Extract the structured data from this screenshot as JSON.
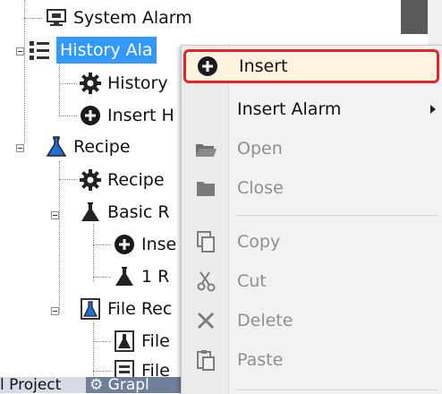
{
  "tree": {
    "system_alarm": "System Alarm",
    "history_alarm": "History Ala",
    "history_setting": "History",
    "insert_history": "Insert H",
    "recipe": "Recipe",
    "recipe_setting": "Recipe",
    "basic_recipe": "Basic R",
    "insert_basic": "Inse",
    "recipe_1": "1 R",
    "file_recipe": "File Rec",
    "file_item_1": "File",
    "file_item_2": "File"
  },
  "tabs": {
    "left_tab": "l Project",
    "right_tab": "Grapl"
  },
  "context_menu": {
    "items": [
      {
        "label": "Insert",
        "icon": "plus-circle-icon",
        "enabled": true,
        "selected": true
      },
      {
        "label": "Insert Alarm",
        "icon": "",
        "enabled": true,
        "submenu": true
      },
      {
        "label": "Open",
        "icon": "folder-open-icon",
        "enabled": false
      },
      {
        "label": "Close",
        "icon": "folder-closed-icon",
        "enabled": false
      },
      {
        "label": "Copy",
        "icon": "copy-icon",
        "enabled": false
      },
      {
        "label": "Cut",
        "icon": "scissors-icon",
        "enabled": false
      },
      {
        "label": "Delete",
        "icon": "x-icon",
        "enabled": false
      },
      {
        "label": "Paste",
        "icon": "paste-icon",
        "enabled": false
      }
    ]
  },
  "colors": {
    "selection": "#3399ff",
    "menu_highlight_border": "#e0252a",
    "menu_highlight_fill": "#fdf3de"
  }
}
